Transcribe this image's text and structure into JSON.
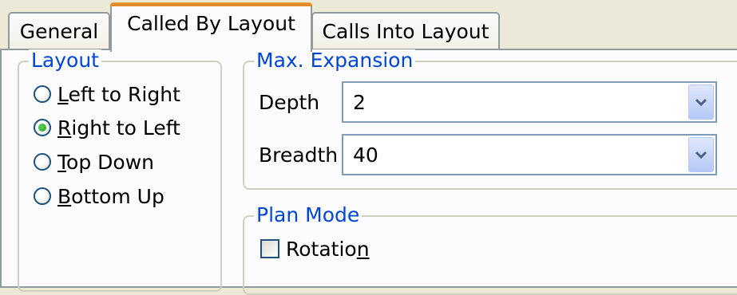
{
  "tabs": [
    {
      "label": "General",
      "selected": false
    },
    {
      "label": "Called By Layout",
      "selected": true
    },
    {
      "label": "Calls Into Layout",
      "selected": false
    }
  ],
  "layout_group": {
    "title": "Layout",
    "options": [
      {
        "pre": "",
        "accel": "L",
        "post": "eft to Right",
        "selected": false
      },
      {
        "pre": "",
        "accel": "R",
        "post": "ight to Left",
        "selected": true
      },
      {
        "pre": "",
        "accel": "T",
        "post": "op Down",
        "selected": false
      },
      {
        "pre": "",
        "accel": "B",
        "post": "ottom Up",
        "selected": false
      }
    ]
  },
  "max_expansion": {
    "title": "Max. Expansion",
    "depth": {
      "label": "Depth",
      "value": "2"
    },
    "breadth": {
      "label": "Breadth",
      "value": "40"
    }
  },
  "plan_mode": {
    "title": "Plan Mode",
    "rotation": {
      "pre": "Rotatio",
      "accel": "n",
      "post": "",
      "checked": false
    }
  },
  "colors": {
    "window_bg": "#ece9d8",
    "panel_bg": "#fcfcfe",
    "group_title": "#0046d5",
    "selected_tab_accent": "#e68b2c",
    "radio_dot": "#21a121",
    "combo_border": "#7f9db9"
  },
  "icons": {
    "combo_arrow": "chevron-down-icon"
  }
}
